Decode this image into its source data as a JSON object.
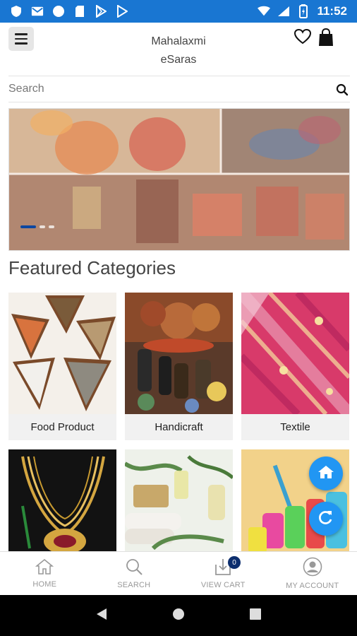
{
  "status_bar": {
    "time": "11:52",
    "left_icons": [
      "shield-icon",
      "mail-icon",
      "circle-icon",
      "sd-card-icon",
      "play-store-icon",
      "play-icon"
    ],
    "right_icons": [
      "wifi-icon",
      "signal-icon",
      "battery-icon"
    ]
  },
  "header": {
    "brand_line1": "Mahalaxmi",
    "brand_line2": "eSaras",
    "icons": [
      "menu-icon",
      "heart-icon",
      "shopping-bag-icon"
    ]
  },
  "search": {
    "placeholder": "Search"
  },
  "banner": {
    "slide_count": 3,
    "active_slide": 1
  },
  "featured": {
    "title": "Featured Categories",
    "categories": [
      {
        "label": "Food Product"
      },
      {
        "label": "Handicraft"
      },
      {
        "label": "Textile"
      },
      {
        "label": ""
      },
      {
        "label": ""
      },
      {
        "label": ""
      }
    ]
  },
  "fabs": [
    "home-icon",
    "refresh-icon"
  ],
  "bottom_nav": {
    "items": [
      {
        "label": "HOME",
        "icon": "home-icon"
      },
      {
        "label": "SEARCH",
        "icon": "search-icon"
      },
      {
        "label": "VIEW CART",
        "icon": "cart-download-icon"
      },
      {
        "label": "MY ACCOUNT",
        "icon": "account-icon"
      }
    ],
    "cart_count": "0"
  },
  "colors": {
    "status_bar": "#1976d2",
    "fab": "#2196f3",
    "badge": "#0d2e6e",
    "nav_text": "#999999"
  }
}
